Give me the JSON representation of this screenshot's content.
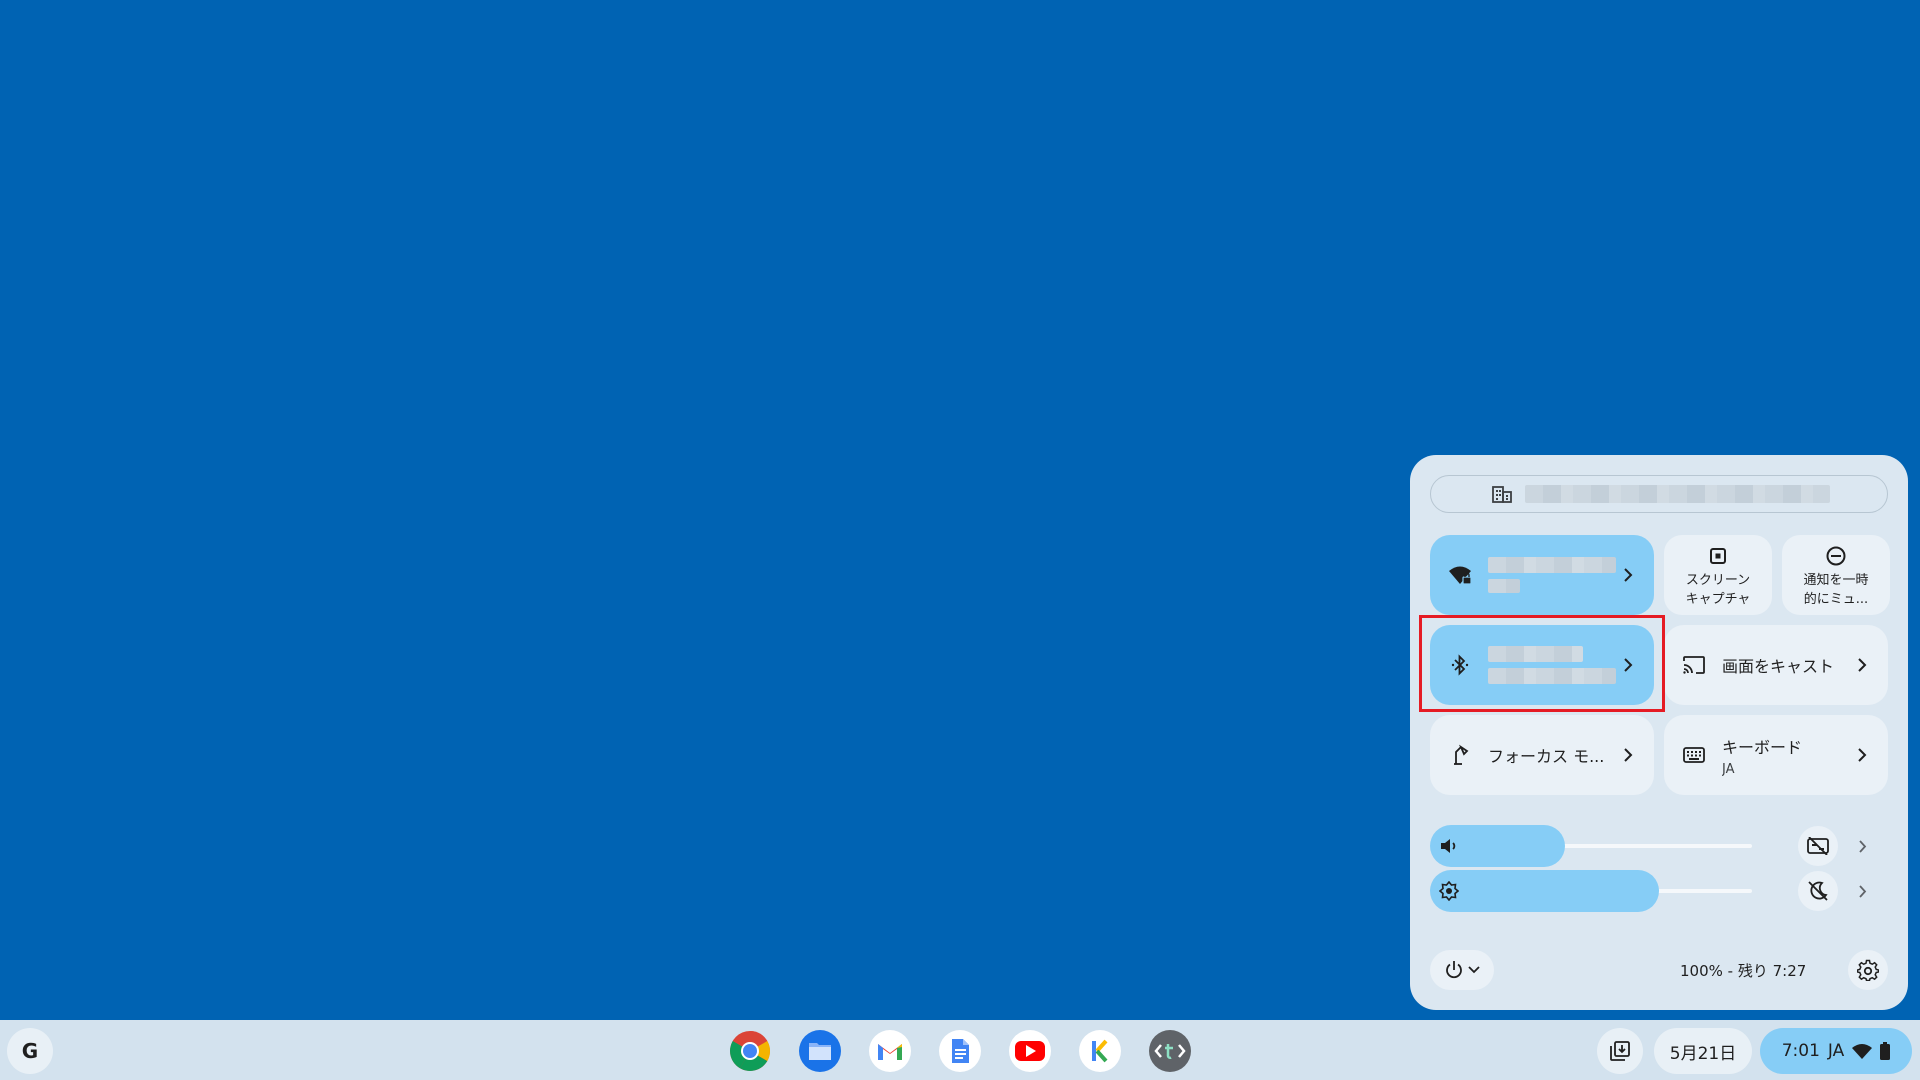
{
  "quick_settings": {
    "managed_label": "",
    "network_tile": {
      "name": "",
      "status": ""
    },
    "screen_capture_label_1": "スクリーン",
    "screen_capture_label_2": "キャプチャ",
    "dnd_label_1": "通知を一時",
    "dnd_label_2": "的にミュ...",
    "bluetooth_tile": {
      "name": "",
      "status": ""
    },
    "cast_label": "画面をキャスト",
    "focus_label": "フォーカス モ...",
    "keyboard_label": "キーボード",
    "keyboard_sub": "JA",
    "volume_level": 0.42,
    "brightness_level": 0.71,
    "battery_text": "100% - 残り 7:27"
  },
  "shelf": {
    "launcher_label": "G",
    "apps": [
      "chrome-icon",
      "files-icon",
      "gmail-icon",
      "docs-icon",
      "youtube-icon",
      "kami-icon",
      "text-editor-icon"
    ],
    "date": "5月21日",
    "time": "7:01",
    "ime": "JA"
  },
  "colors": {
    "wallpaper": "#0063b3",
    "panel": "#dbe7f1",
    "tile_on": "#86cdf6",
    "tile_off": "#eaf1f7",
    "highlight": "#e51b24"
  }
}
